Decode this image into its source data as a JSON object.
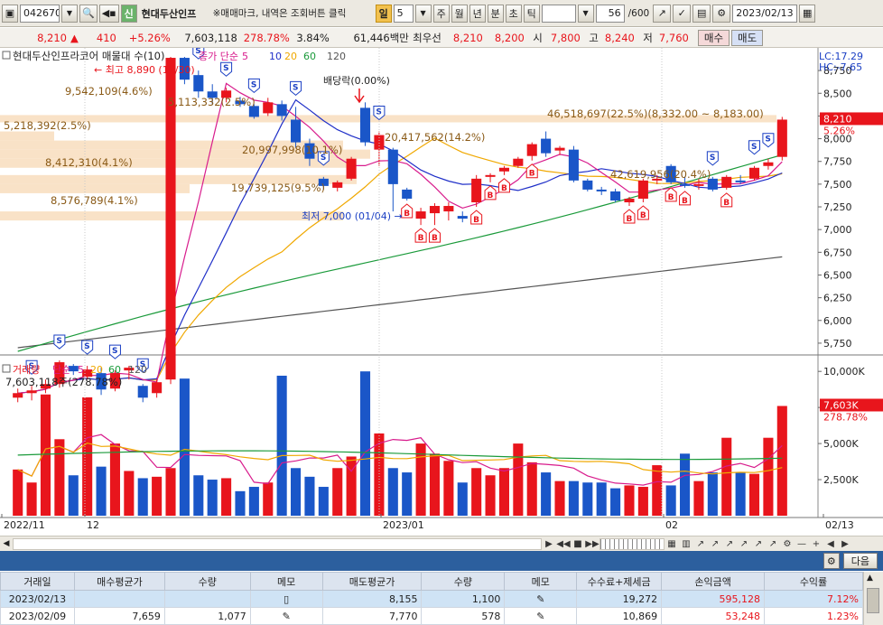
{
  "toolbar": {
    "code": "042670",
    "name_badge": "신",
    "stock_name": "현대두산인프",
    "hint": "※매매마크, 내역은 조회버튼 클릭",
    "period_selected": "일",
    "period_value": "5",
    "periods": [
      "주",
      "월",
      "년",
      "분",
      "초",
      "틱"
    ],
    "count": "56",
    "count_max": "/600",
    "date": "2023/02/13"
  },
  "quote": {
    "price": "8,210",
    "change": "410",
    "change_pct": "+5.26%",
    "volume": "7,603,118",
    "volume_ratio": "278.78%",
    "turnover": "3.84%",
    "amount": "61,446백만",
    "priority_label": "최우선",
    "ask": "8,210",
    "bid": "8,200",
    "open_label": "시",
    "open": "7,800",
    "high_label": "고",
    "high": "8,240",
    "low_label": "저",
    "low": "7,760",
    "buy_label": "매수",
    "sell_label": "매도"
  },
  "price_panel": {
    "legend_name": "현대두산인프라코어 매물대 수(10)",
    "legend_ma_label": "종가 단순",
    "ma_periods": [
      "5",
      "10",
      "20",
      "60",
      "120"
    ],
    "ma_colors": [
      "#d81b8c",
      "#1f2fc8",
      "#f0a800",
      "#1a9a3a",
      "#555555"
    ],
    "lc": "LC:17.29",
    "hc": "HC:-7.65",
    "price_badge": "8,210",
    "pct_badge": "5.26%",
    "high_note": "최고 8,890 (11/30)",
    "low_note": "최저 7,000 (01/04)",
    "dividend_note": "배당락(0.00%)",
    "yaxis": [
      "8,750",
      "8,500",
      "8,250",
      "8,000",
      "7,750",
      "7,500",
      "7,250",
      "7,000",
      "6,750",
      "6,500",
      "6,250",
      "6,000",
      "5,750"
    ],
    "profile_labels": [
      "9,542,109(4.6%)",
      "5,218,392(2.5%)",
      "8,412,310(4.1%)",
      "8,576,789(4.1%)",
      "5,113,332(2.5%)",
      "20,997,998(10.1%)",
      "19,739,125(9.5%)",
      "20,417,562(14.2%)",
      "46,518,697(22.5%)(8,332.00 ~ 8,183.00)",
      "42,619,956(20.4%)"
    ],
    "buy_mark": "B",
    "sell_mark": "S"
  },
  "volume_panel": {
    "legend_name": "거래량",
    "legend_ma_label": "단순",
    "ma_periods": [
      "5",
      "20",
      "60",
      "120"
    ],
    "ma_colors": [
      "#d81b8c",
      "#f0a800",
      "#1a9a3a",
      "#555555"
    ],
    "current": "7,603,118주(278.78%)",
    "yaxis": [
      "10,000K",
      "7,500K",
      "5,000K",
      "2,500K"
    ],
    "badge": "7,603K",
    "badge_pct": "278.78%"
  },
  "xaxis": [
    "2022/11",
    "12",
    "2023/01",
    "02",
    "02/13"
  ],
  "table": {
    "headers": [
      "거래일",
      "매수평균가",
      "수량",
      "메모",
      "매도평균가",
      "수량",
      "메모",
      "수수료+제세금",
      "손익금액",
      "수익률"
    ],
    "rows": [
      [
        "2023/02/13",
        "",
        "",
        "",
        "8,155",
        "1,100",
        "",
        "19,272",
        "595,128",
        "7.12%"
      ],
      [
        "2023/02/09",
        "7,659",
        "1,077",
        "",
        "7,770",
        "578",
        "",
        "10,869",
        "53,248",
        "1.23%"
      ]
    ],
    "next_label": "다음"
  },
  "chart_data": {
    "type": "candlestick",
    "title": "현대두산인프라코어",
    "ylim": [
      5650,
      8950
    ],
    "x_ticks": [
      "2022/11",
      "12",
      "2023/01",
      "02",
      "02/13"
    ],
    "candles": [
      [
        5150,
        5250,
        5100,
        5200
      ],
      [
        5200,
        5280,
        5120,
        5230
      ],
      [
        5250,
        5350,
        5200,
        5300
      ],
      [
        5300,
        5560,
        5260,
        5540
      ],
      [
        5500,
        5520,
        5400,
        5440
      ],
      [
        5380,
        5500,
        5350,
        5460
      ],
      [
        5420,
        5480,
        5180,
        5240
      ],
      [
        5250,
        5450,
        5220,
        5420
      ],
      [
        5450,
        5500,
        5350,
        5480
      ],
      [
        5280,
        5300,
        5100,
        5150
      ],
      [
        5200,
        5350,
        5150,
        5320
      ],
      [
        5350,
        8900,
        5300,
        8890
      ],
      [
        8890,
        8900,
        8600,
        8650
      ],
      [
        8700,
        8750,
        8450,
        8520
      ],
      [
        8520,
        8600,
        8380,
        8450
      ],
      [
        8450,
        8560,
        8400,
        8530
      ],
      [
        8420,
        8460,
        8350,
        8380
      ],
      [
        8360,
        8380,
        8220,
        8240
      ],
      [
        8280,
        8450,
        8250,
        8400
      ],
      [
        8380,
        8420,
        8200,
        8250
      ],
      [
        8210,
        8350,
        7900,
        7960
      ],
      [
        7950,
        8000,
        7700,
        7780
      ],
      [
        7560,
        7580,
        7440,
        7480
      ],
      [
        7460,
        7540,
        7420,
        7520
      ],
      [
        7560,
        7800,
        7540,
        7780
      ],
      [
        8340,
        8400,
        7920,
        7960
      ],
      [
        7880,
        8080,
        7700,
        8040
      ],
      [
        7880,
        7900,
        7200,
        7500
      ],
      [
        7440,
        7460,
        7320,
        7340
      ],
      [
        7120,
        7240,
        7050,
        7200
      ],
      [
        7180,
        7290,
        7050,
        7260
      ],
      [
        7200,
        7300,
        7100,
        7260
      ],
      [
        7150,
        7200,
        7080,
        7120
      ],
      [
        7300,
        7600,
        7250,
        7560
      ],
      [
        7580,
        7620,
        7520,
        7600
      ],
      [
        7640,
        7700,
        7600,
        7680
      ],
      [
        7700,
        7800,
        7680,
        7780
      ],
      [
        7810,
        7960,
        7760,
        7940
      ],
      [
        8000,
        8080,
        7800,
        7840
      ],
      [
        7870,
        7920,
        7820,
        7900
      ],
      [
        7880,
        7920,
        7520,
        7540
      ],
      [
        7540,
        7560,
        7420,
        7440
      ],
      [
        7440,
        7470,
        7380,
        7420
      ],
      [
        7420,
        7450,
        7300,
        7320
      ],
      [
        7300,
        7360,
        7260,
        7340
      ],
      [
        7340,
        7560,
        7300,
        7540
      ],
      [
        7540,
        7600,
        7500,
        7560
      ],
      [
        7700,
        7720,
        7500,
        7520
      ],
      [
        7500,
        7580,
        7460,
        7480
      ],
      [
        7480,
        7560,
        7440,
        7500
      ],
      [
        7560,
        7580,
        7420,
        7440
      ],
      [
        7460,
        7600,
        7440,
        7580
      ],
      [
        7540,
        7600,
        7500,
        7520
      ],
      [
        7560,
        7700,
        7540,
        7680
      ],
      [
        7700,
        7780,
        7660,
        7740
      ],
      [
        7800,
        8240,
        7760,
        8210
      ]
    ],
    "volume_k": [
      3200,
      2300,
      8400,
      5300,
      2800,
      8200,
      3400,
      5000,
      3100,
      2600,
      2700,
      3300,
      9500,
      2800,
      2500,
      2600,
      1700,
      2000,
      2300,
      9700,
      3300,
      2700,
      2000,
      3300,
      4100,
      10000,
      5700,
      3300,
      3000,
      5000,
      4300,
      3800,
      2300,
      3300,
      2800,
      3300,
      5000,
      3700,
      3000,
      2400,
      2400,
      2300,
      2300,
      1900,
      2100,
      2000,
      3500,
      2100,
      4300,
      2400,
      3000,
      5400,
      3000,
      2900,
      5400,
      7603
    ]
  }
}
